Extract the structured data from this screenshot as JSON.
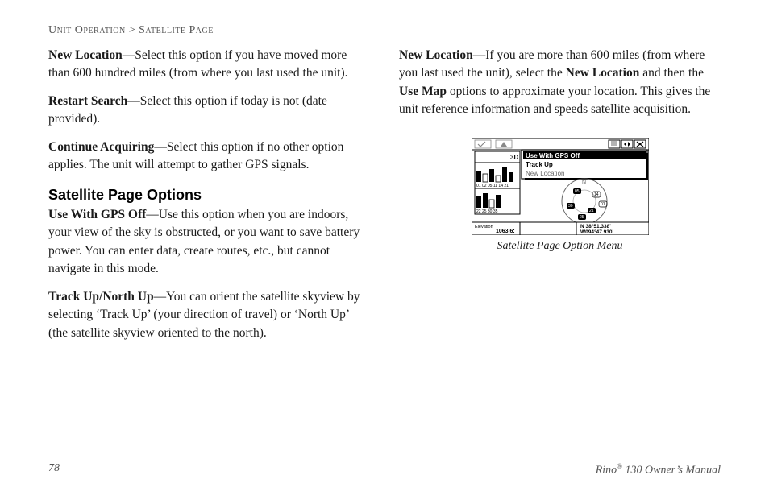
{
  "breadcrumb": {
    "section": "Unit Operation",
    "sep": " > ",
    "page": "Satellite Page"
  },
  "left": {
    "p1": {
      "b": "New Location",
      "t": "—Select this option if you have moved more than 600 hundred miles (from where you last used the unit)."
    },
    "p2": {
      "b": "Restart Search",
      "t": "—Select this option if today is not (date provided)."
    },
    "p3": {
      "b": "Continue Acquiring",
      "t": "—Select this option if no other option applies. The unit will attempt to gather GPS signals."
    },
    "h2": "Satellite Page Options",
    "p4": {
      "b": "Use With GPS Off",
      "t": "—Use this option when you are indoors, your view of the sky is obstructed, or you want to save battery power. You can enter data, create routes, etc., but cannot navigate in this mode."
    },
    "p5": {
      "b": "Track Up/North Up",
      "t": "—You can orient the satellite skyview by selecting ‘Track Up’ (your direction of travel) or ‘North Up’ (the satellite skyview oriented to the north)."
    }
  },
  "right": {
    "p1": {
      "b1": "New Location",
      "t1": "—If you are more than 600 miles (from where you last used the unit), select the ",
      "b2": "New Location",
      "t2": " and then the ",
      "b3": "Use Map",
      "t3": " options to approximate your location. This gives the unit reference information and speeds satellite acquisition."
    },
    "caption": "Satellite Page Option Menu",
    "screenshot": {
      "menu1": "Use With GPS Off",
      "menu2": "Track Up",
      "menu3": "New Location",
      "elev_label": "Elevation",
      "elev_value": "1063.6:",
      "coord1": "N  38°51.338'",
      "coord2": "W094°47.930'",
      "sat_bar_label1": "01 02 05 11 14 21",
      "sat_bar_label2": "22 25 30 35",
      "signal_label": "3D"
    }
  },
  "footer": {
    "page_number": "78",
    "product_a": "Rino",
    "product_sup": "®",
    "product_b": " 130 Owner’s Manual"
  }
}
